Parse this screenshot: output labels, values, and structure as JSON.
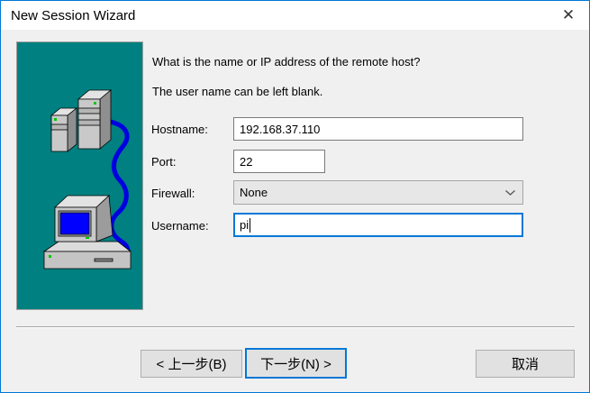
{
  "window": {
    "title": "New Session Wizard",
    "accent_color": "#0078d7",
    "titlebar_background": "#ffffff",
    "body_background": "#f0f0f0"
  },
  "icons": {
    "close": "✕",
    "chevron_down": "⌄",
    "artwork": "servers-and-desktop-computer-connected-by-cable"
  },
  "art_panel": {
    "background": "#008080",
    "cable_color": "#0000e0",
    "screen_color": "#0000ff",
    "led_color": "#00c800"
  },
  "main": {
    "question": "What is the name or IP address of the remote host?",
    "hint": "The user name can be left blank.",
    "fields": {
      "hostname": {
        "label": "Hostname:",
        "value": "192.168.37.110"
      },
      "port": {
        "label": "Port:",
        "value": "22"
      },
      "firewall": {
        "label": "Firewall:",
        "value": "None"
      },
      "username": {
        "label": "Username:",
        "value": "pi",
        "focused": true
      }
    }
  },
  "buttons": {
    "back": "< 上一步(B)",
    "next": "下一步(N) >",
    "cancel": "取消"
  }
}
